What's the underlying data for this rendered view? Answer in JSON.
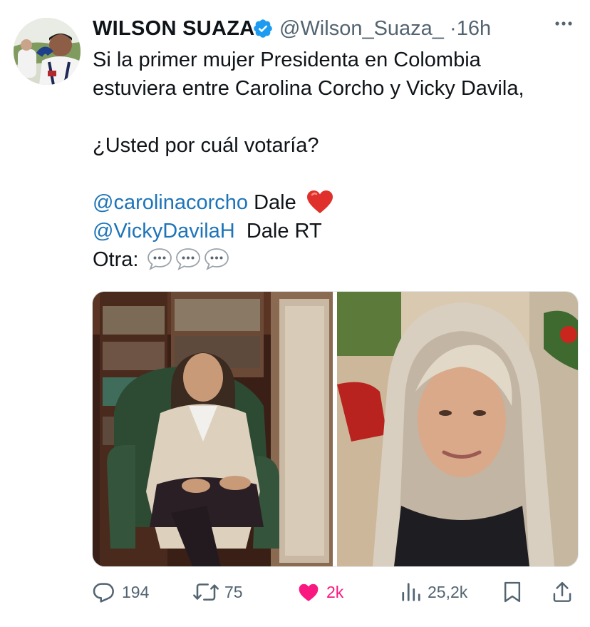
{
  "author": {
    "display_name": "WILSON SUAZA",
    "handle": "@Wilson_Suaza_",
    "separator": "·",
    "time": "16h"
  },
  "icons": {
    "verified": "verified-badge-icon",
    "more": "more-options-icon",
    "heart_emoji": "red-heart-emoji",
    "speech_bubble": "speech-bubble-emoji",
    "reply": "reply-icon",
    "retweet": "retweet-icon",
    "like": "like-heart-icon",
    "views": "views-chart-icon",
    "bookmark": "bookmark-icon",
    "share": "share-icon"
  },
  "tweet": {
    "line1": "Si la primer mujer Presidenta en Colombia",
    "line2": "estuviera entre Carolina Corcho y Vicky Davila,",
    "line3": "¿Usted por cuál votaría?",
    "mention1": "@carolinacorcho",
    "mention1_suffix": " Dale",
    "mention2": "@VickyDavilaH",
    "mention2_suffix": "  Dale RT",
    "line_other": "Otra:"
  },
  "media": {
    "left": "photo-woman-in-armchair",
    "right": "photo-woman-blonde-portrait"
  },
  "actions": {
    "replies": "194",
    "retweets": "75",
    "likes": "2k",
    "views": "25,2k"
  },
  "colors": {
    "text": "#0f1419",
    "secondary": "#536471",
    "mention": "#1d74b8",
    "like": "#f91880",
    "verified": "#1d9bf0",
    "heart": "#e0302c"
  }
}
